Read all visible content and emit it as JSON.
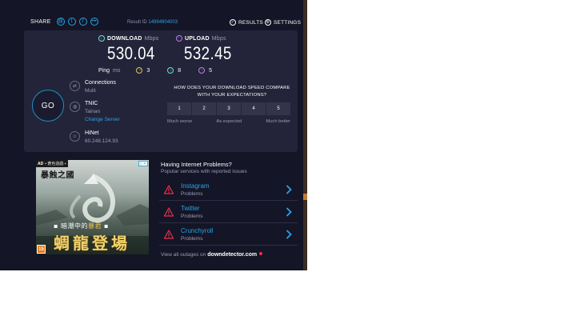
{
  "header": {
    "share_label": "SHARE",
    "share_icons": [
      "link-icon",
      "twitter-icon",
      "facebook-icon",
      "more-icon"
    ],
    "result_id_label": "Result ID",
    "result_id_value": "14994904003",
    "results_label": "RESULTS",
    "settings_label": "SETTINGS"
  },
  "speed": {
    "download_label": "DOWNLOAD",
    "download_unit": "Mbps",
    "download_value": "530.04",
    "upload_label": "UPLOAD",
    "upload_unit": "Mbps",
    "upload_value": "532.45"
  },
  "ping": {
    "label": "Ping",
    "unit": "ms",
    "idle": "3",
    "download": "8",
    "upload": "5"
  },
  "go_label": "GO",
  "connection": {
    "connections_title": "Connections",
    "connections_value": "Multi",
    "server_name": "TNIC",
    "server_location": "Tainan",
    "change_server_label": "Change Server",
    "isp_name": "HiNet",
    "ip_address": "60.248.124.93"
  },
  "survey": {
    "question": "HOW DOES YOUR DOWNLOAD SPEED COMPARE WITH YOUR EXPECTATIONS?",
    "options": [
      "1",
      "2",
      "3",
      "4",
      "5"
    ],
    "label_low": "Much worse",
    "label_mid": "As expected",
    "label_high": "Much better"
  },
  "ad": {
    "ad_label": "AD",
    "brand": "▪ 蒼色遊戲 ▪",
    "title": "暴蝕之國",
    "tagline_a": "▪ 暗潮中的",
    "tagline_highlight": "暴君",
    "tagline_b": " ▪",
    "headline": "蜩龍登場",
    "rating": "15"
  },
  "problems": {
    "title": "Having Internet Problems?",
    "subtitle": "Popular services with reported issues",
    "items": [
      {
        "name": "Instagram",
        "status": "Problems"
      },
      {
        "name": "Twitter",
        "status": "Problems"
      },
      {
        "name": "Crunchyroll",
        "status": "Problems"
      }
    ],
    "footer_prefix": "View all outages on",
    "footer_brand": "downdetector.com"
  },
  "colors": {
    "background": "#141526",
    "panel": "#232439",
    "accent_blue": "#2aa3e6",
    "download": "#6ee2d8",
    "upload": "#c27de8",
    "ping_idle": "#e6c45b",
    "warning": "#e8314a"
  }
}
